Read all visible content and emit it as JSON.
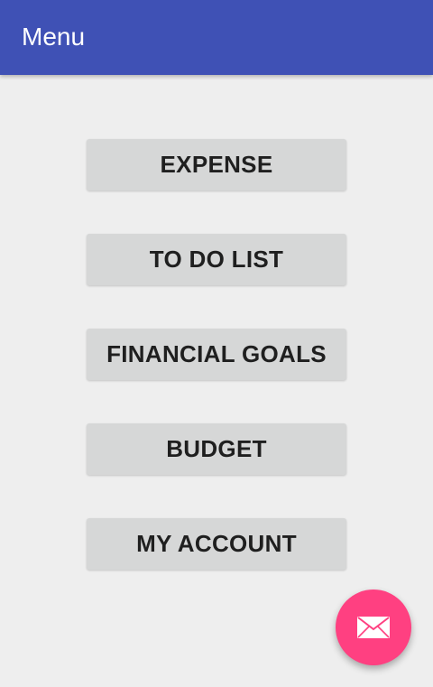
{
  "app_bar": {
    "title": "Menu",
    "color": "#3f51b5"
  },
  "menu": {
    "buttons": [
      {
        "label": "EXPENSE"
      },
      {
        "label": "TO DO LIST"
      },
      {
        "label": "FINANCIAL GOALS"
      },
      {
        "label": "BUDGET"
      },
      {
        "label": "MY ACCOUNT"
      }
    ]
  },
  "fab": {
    "icon": "mail-icon",
    "color": "#ff4081"
  }
}
